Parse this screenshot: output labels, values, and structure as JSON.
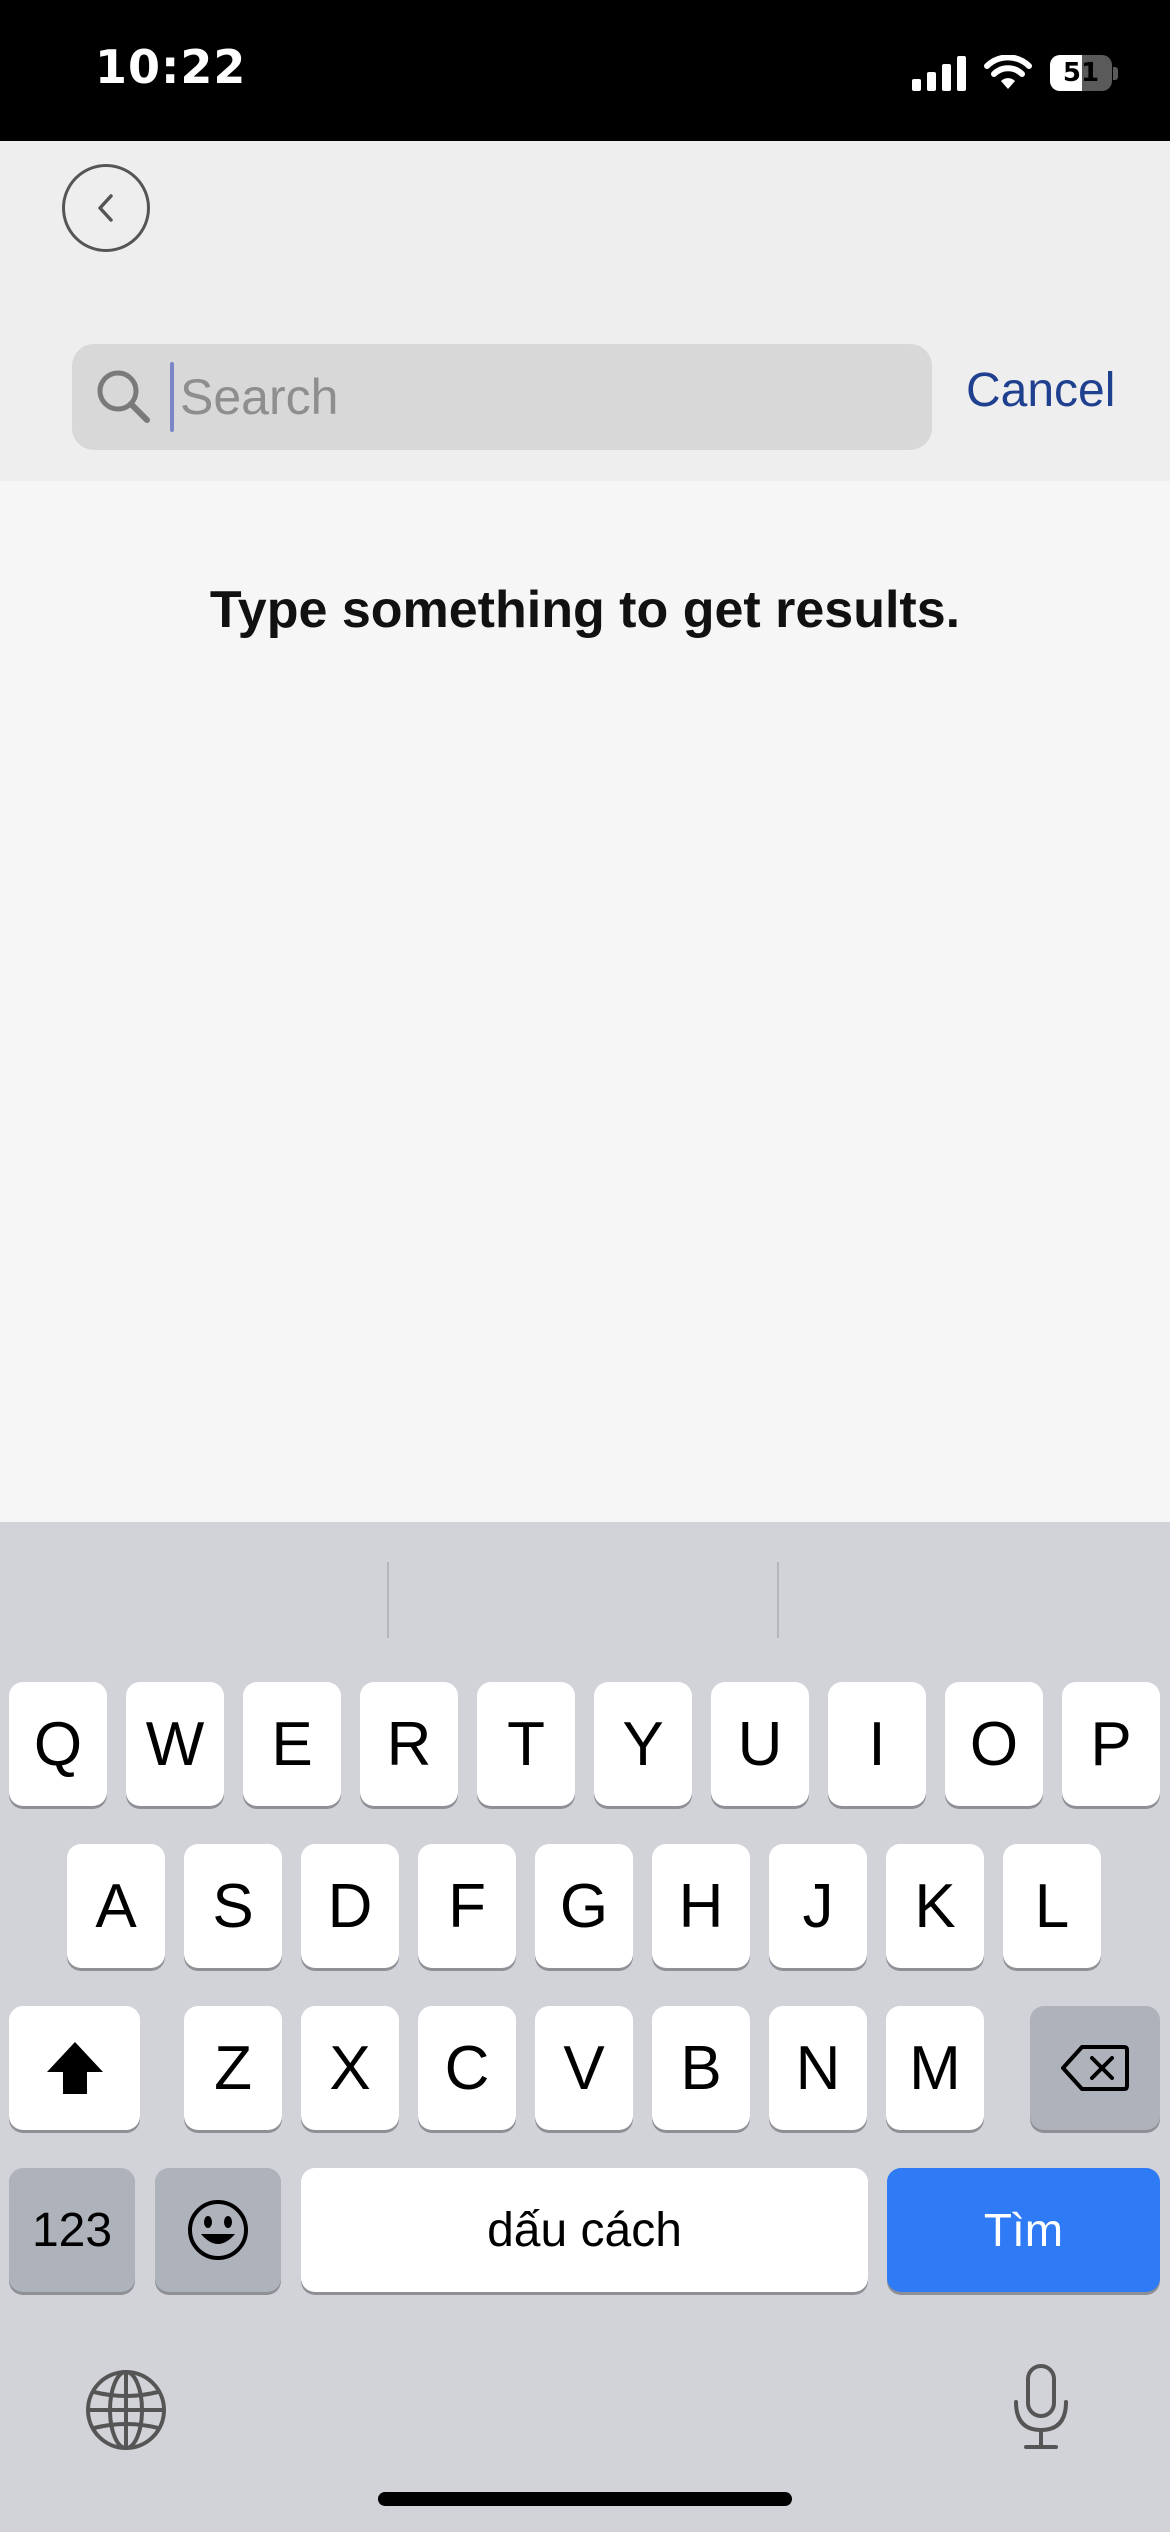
{
  "status_bar": {
    "time": "10:22",
    "battery_level": "51",
    "battery_fraction": 0.51
  },
  "header": {
    "back_icon": "chevron-left-icon",
    "search": {
      "placeholder": "Search",
      "value": "",
      "icon": "search-icon"
    },
    "cancel_label": "Cancel"
  },
  "main": {
    "empty_message": "Type something to get results."
  },
  "keyboard": {
    "row1": [
      "Q",
      "W",
      "E",
      "R",
      "T",
      "Y",
      "U",
      "I",
      "O",
      "P"
    ],
    "row2": [
      "A",
      "S",
      "D",
      "F",
      "G",
      "H",
      "J",
      "K",
      "L"
    ],
    "row3": [
      "Z",
      "X",
      "C",
      "V",
      "B",
      "N",
      "M"
    ],
    "numbers_label": "123",
    "space_label": "dấu cách",
    "return_label": "Tìm",
    "icons": {
      "shift": "shift-icon",
      "delete": "backspace-icon",
      "emoji": "emoji-icon",
      "globe": "globe-icon",
      "mic": "microphone-icon"
    }
  },
  "colors": {
    "accent": "#2f7af5",
    "cancel": "#1f3f8f",
    "header_bg": "#eeeeee",
    "keyboard_bg": "#d1d3d9"
  }
}
